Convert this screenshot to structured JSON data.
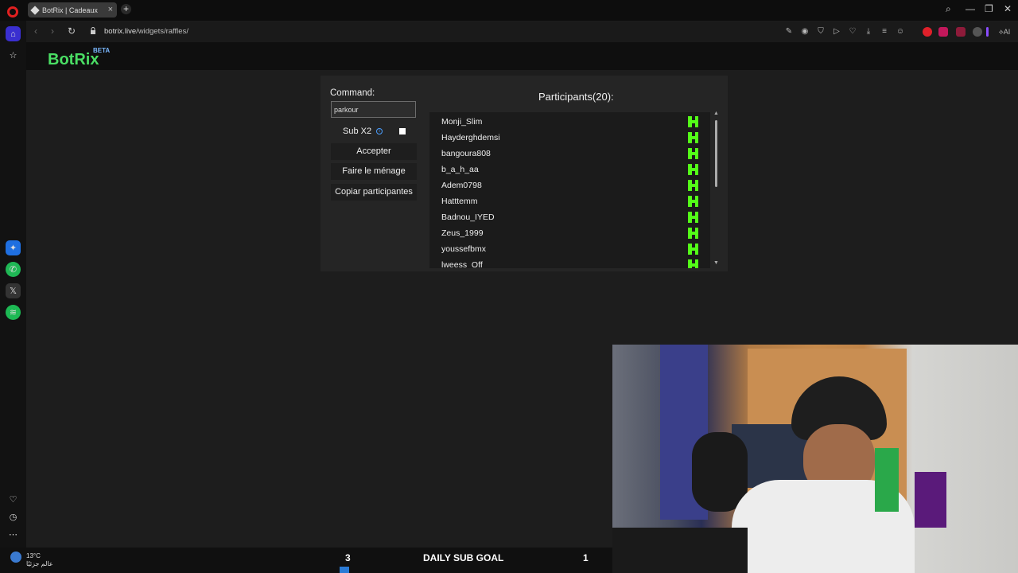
{
  "browser": {
    "tab_title": "BotRix | Cadeaux",
    "url_host": "botrix.live",
    "url_path": "/widgets/raffles/",
    "ai_label": "AI"
  },
  "site": {
    "brand": "BotRix",
    "beta": "BETA"
  },
  "form": {
    "command_label": "Command:",
    "command_value": "parkour",
    "sub_label": "Sub X2",
    "sub_checked": false,
    "accept_button": "Accepter",
    "clean_button": "Faire le ménage",
    "copy_button": "Copiar participantes"
  },
  "participants": {
    "title": "Participants(20):",
    "items": [
      "Monji_Slim",
      "Hayderghdemsi",
      "bangoura808",
      "b_a_h_aa",
      "Adem0798",
      "Hatttemm",
      "Badnou_IYED",
      "Zeus_1999",
      "youssefbmx",
      "lweess_Off"
    ],
    "platform_icon": "kick-icon",
    "platform_color": "#53fc18"
  },
  "taskbar": {
    "temperature": "13°C",
    "weather_text": "عالم جزئيًا",
    "goal_left": "3",
    "goal_label": "DAILY SUB GOAL",
    "goal_right": "1"
  },
  "colors": {
    "brand": "#4ade64",
    "beta": "#7ab8ff",
    "panel": "#252525",
    "opera": "#e02020"
  }
}
